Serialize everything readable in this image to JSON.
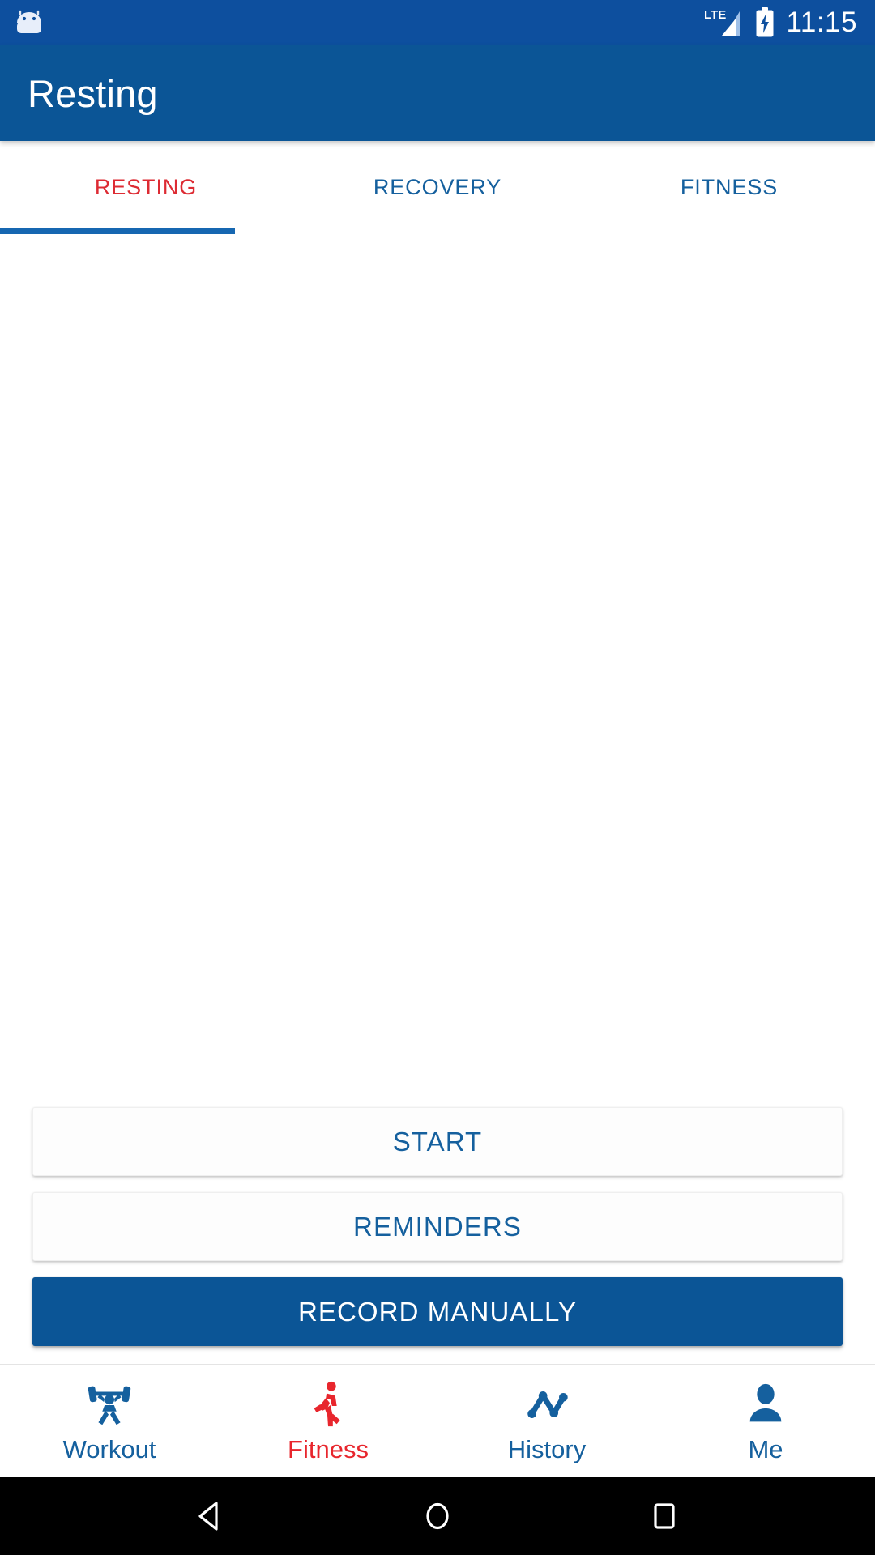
{
  "status_bar": {
    "robot_icon": "android-robot-icon",
    "network_label": "LTE",
    "signal_icon": "signal-bars-icon",
    "battery_icon": "battery-charging-icon",
    "clock": "11:15",
    "background_color": "#0d4f9e"
  },
  "app_bar": {
    "title": "Resting",
    "background_color": "#0b5596"
  },
  "tabs": {
    "active_index": 0,
    "indicator_color": "#1667b1",
    "active_color": "#dd2b33",
    "inactive_color": "#15609e",
    "items": [
      {
        "label": "RESTING"
      },
      {
        "label": "RECOVERY"
      },
      {
        "label": "FITNESS"
      }
    ]
  },
  "actions": {
    "start_label": "START",
    "reminders_label": "REMINDERS",
    "record_manually_label": "RECORD MANUALLY",
    "outlined_text_color": "#15609e",
    "filled_background_color": "#0b5596",
    "filled_text_color": "#ffffff"
  },
  "bottom_nav": {
    "active_index": 1,
    "active_color": "#e8262d",
    "inactive_color": "#15609e",
    "items": [
      {
        "label": "Workout",
        "icon": "weightlifter-icon"
      },
      {
        "label": "Fitness",
        "icon": "running-person-icon"
      },
      {
        "label": "History",
        "icon": "line-chart-icon"
      },
      {
        "label": "Me",
        "icon": "person-icon"
      }
    ]
  },
  "system_nav": {
    "back_icon": "back-triangle-icon",
    "home_icon": "home-circle-icon",
    "recents_icon": "recents-square-icon",
    "background_color": "#000000"
  }
}
